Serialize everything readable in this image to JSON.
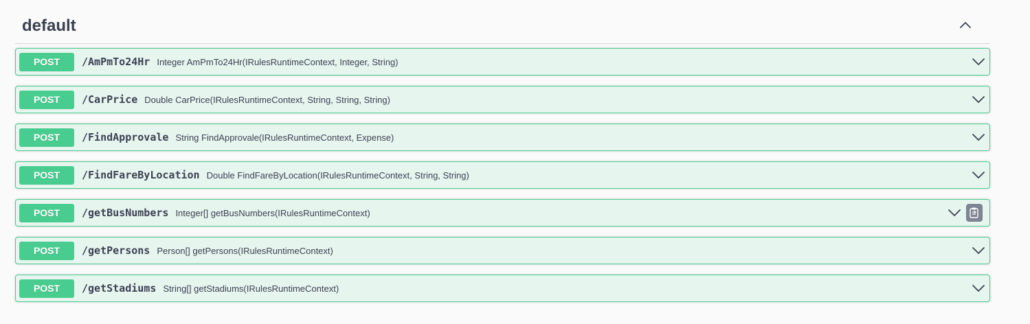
{
  "tag": {
    "title": "default",
    "collapse_icon": "chevron-up-icon"
  },
  "operations": [
    {
      "method": "POST",
      "path": "/AmPmTo24Hr",
      "summary": "Integer AmPmTo24Hr(IRulesRuntimeContext, Integer, String)"
    },
    {
      "method": "POST",
      "path": "/CarPrice",
      "summary": "Double CarPrice(IRulesRuntimeContext, String, String, String)"
    },
    {
      "method": "POST",
      "path": "/FindApprovale",
      "summary": "String FindApprovale(IRulesRuntimeContext, Expense)"
    },
    {
      "method": "POST",
      "path": "/FindFareByLocation",
      "summary": "Double FindFareByLocation(IRulesRuntimeContext, String, String)"
    },
    {
      "method": "POST",
      "path": "/getBusNumbers",
      "summary": "Integer[] getBusNumbers(IRulesRuntimeContext)",
      "has_copy_button": true
    },
    {
      "method": "POST",
      "path": "/getPersons",
      "summary": "Person[] getPersons(IRulesRuntimeContext)"
    },
    {
      "method": "POST",
      "path": "/getStadiums",
      "summary": "String[] getStadiums(IRulesRuntimeContext)"
    }
  ],
  "colors": {
    "post": "#49cc90",
    "post_bg": "#edf8f2",
    "text": "#3b4151",
    "copy_button": "#7d8492"
  },
  "icons": {
    "expand": "chevron-down-icon",
    "copy": "clipboard-icon"
  }
}
